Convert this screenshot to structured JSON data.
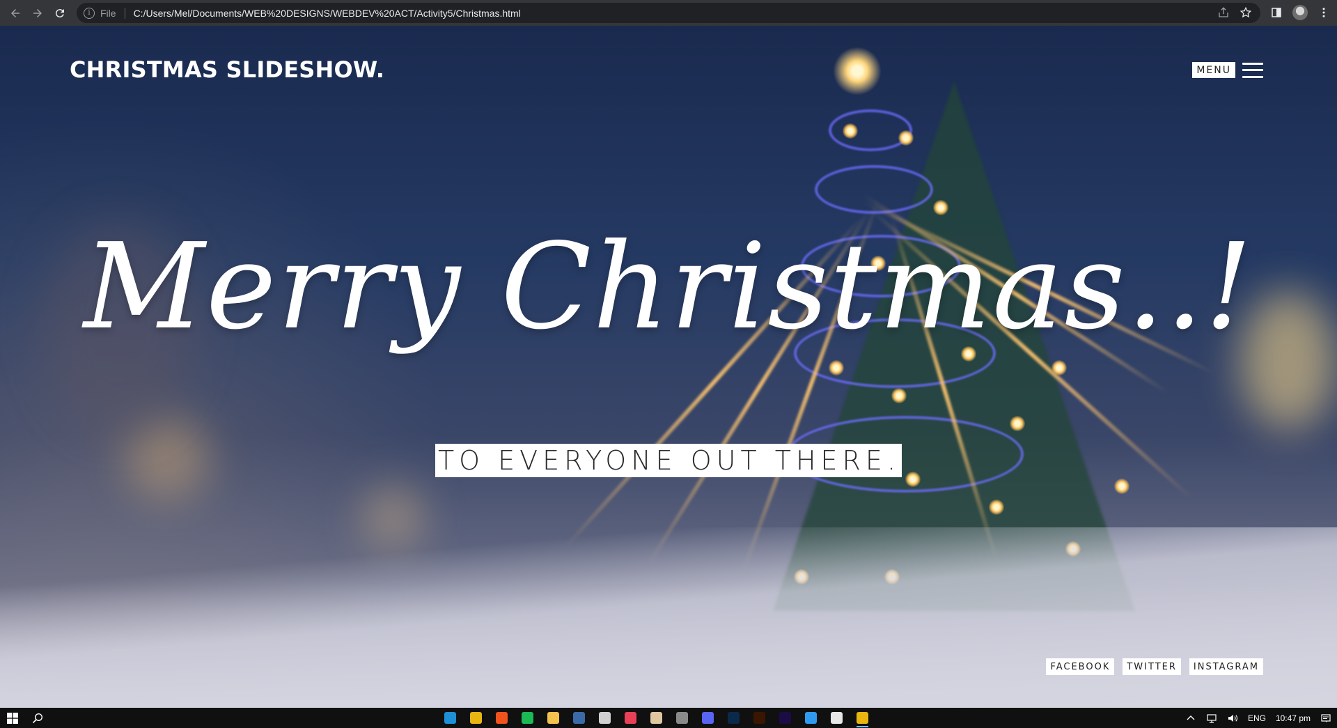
{
  "browser": {
    "scheme_label": "File",
    "url": "C:/Users/Mel/Documents/WEB%20DESIGNS/WEBDEV%20ACT/Activity5/Christmas.html"
  },
  "page": {
    "brand": "CHRISTMAS SLIDESHOW.",
    "menu_label": "MENU",
    "headline": "Merry Christmas..!",
    "subline": "TO EVERYONE OUT THERE.",
    "socials": [
      "FACEBOOK",
      "TWITTER",
      "INSTAGRAM"
    ]
  },
  "taskbar": {
    "apps": [
      {
        "name": "edge-icon",
        "color": "#1f8fd6"
      },
      {
        "name": "chrome-icon",
        "color": "#e8b511"
      },
      {
        "name": "brave-icon",
        "color": "#f0531c"
      },
      {
        "name": "spotify-icon",
        "color": "#1db954"
      },
      {
        "name": "file-explorer-icon",
        "color": "#f2c14e"
      },
      {
        "name": "steam-icon",
        "color": "#3b6aa8"
      },
      {
        "name": "epic-games-icon",
        "color": "#d0d0d0"
      },
      {
        "name": "valorant-icon",
        "color": "#e84057"
      },
      {
        "name": "paint-icon",
        "color": "#e0c7a0"
      },
      {
        "name": "misc-app-icon",
        "color": "#8a8a8a"
      },
      {
        "name": "discord-icon",
        "color": "#5865f2"
      },
      {
        "name": "photoshop-icon",
        "color": "#0b2a4a"
      },
      {
        "name": "illustrator-icon",
        "color": "#3a1600"
      },
      {
        "name": "premiere-icon",
        "color": "#1c0c46"
      },
      {
        "name": "vscode-icon",
        "color": "#2f9bf0"
      },
      {
        "name": "unity-icon",
        "color": "#e8e8e8"
      },
      {
        "name": "chrome-active-icon",
        "color": "#e8b511"
      }
    ],
    "language": "ENG",
    "time": "10:47 pm"
  }
}
